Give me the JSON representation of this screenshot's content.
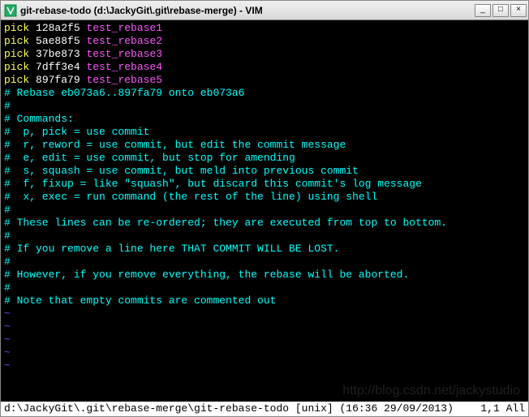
{
  "window": {
    "title": "git-rebase-todo (d:\\JackyGit\\.git\\rebase-merge) - VIM"
  },
  "picks": [
    {
      "cmd": "pick",
      "hash": "128a2f5",
      "msg": "test_rebase1"
    },
    {
      "cmd": "pick",
      "hash": "5ae88f5",
      "msg": "test_rebase2"
    },
    {
      "cmd": "pick",
      "hash": "37be873",
      "msg": "test_rebase3"
    },
    {
      "cmd": "pick",
      "hash": "7dff3e4",
      "msg": "test_rebase4"
    },
    {
      "cmd": "pick",
      "hash": "897fa79",
      "msg": "test_rebase5"
    }
  ],
  "comments": [
    "",
    "# Rebase eb073a6..897fa79 onto eb073a6",
    "#",
    "# Commands:",
    "#  p, pick = use commit",
    "#  r, reword = use commit, but edit the commit message",
    "#  e, edit = use commit, but stop for amending",
    "#  s, squash = use commit, but meld into previous commit",
    "#  f, fixup = like \"squash\", but discard this commit's log message",
    "#  x, exec = run command (the rest of the line) using shell",
    "#",
    "# These lines can be re-ordered; they are executed from top to bottom.",
    "#",
    "# If you remove a line here THAT COMMIT WILL BE LOST.",
    "#",
    "# However, if you remove everything, the rebase will be aborted.",
    "#",
    "# Note that empty commits are commented out"
  ],
  "tildes": [
    "~",
    "~",
    "~",
    "~",
    "~"
  ],
  "status": {
    "left": "d:\\JackyGit\\.git\\rebase-merge\\git-rebase-todo [unix] (16:36 29/09/2013)",
    "right": "  1,1 All"
  },
  "watermark": "http://blog.csdn.net/jackystudio"
}
